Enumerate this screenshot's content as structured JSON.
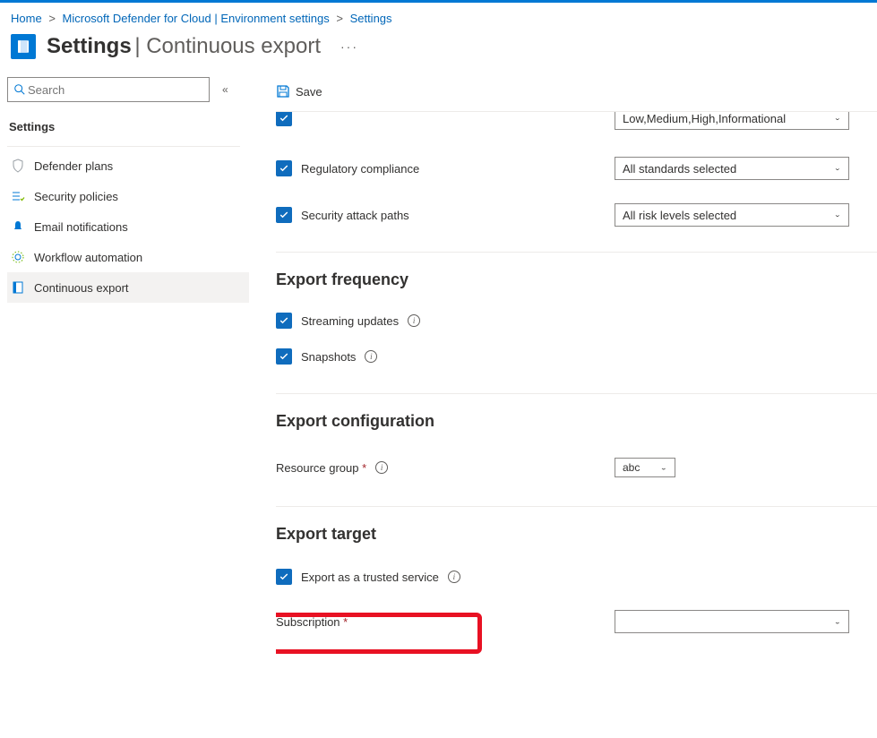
{
  "breadcrumb": {
    "home": "Home",
    "item1": "Microsoft Defender for Cloud | Environment settings",
    "item2": "Settings"
  },
  "header": {
    "title": "Settings",
    "subtitle": "Continuous export"
  },
  "search": {
    "placeholder": "Search"
  },
  "sidebar": {
    "section": "Settings",
    "items": [
      "Defender plans",
      "Security policies",
      "Email notifications",
      "Workflow automation",
      "Continuous export"
    ]
  },
  "toolbar": {
    "save": "Save"
  },
  "partial": {
    "select": "Low,Medium,High,Informational"
  },
  "checks": {
    "regulatory": "Regulatory compliance",
    "regulatory_sel": "All standards selected",
    "attack": "Security attack paths",
    "attack_sel": "All risk levels selected"
  },
  "freq": {
    "title": "Export frequency",
    "streaming": "Streaming updates",
    "snapshots": "Snapshots"
  },
  "config": {
    "title": "Export configuration",
    "rg_label": "Resource group",
    "rg_value": "abc"
  },
  "target": {
    "title": "Export target",
    "trusted": "Export as a trusted service",
    "sub_label": "Subscription"
  }
}
